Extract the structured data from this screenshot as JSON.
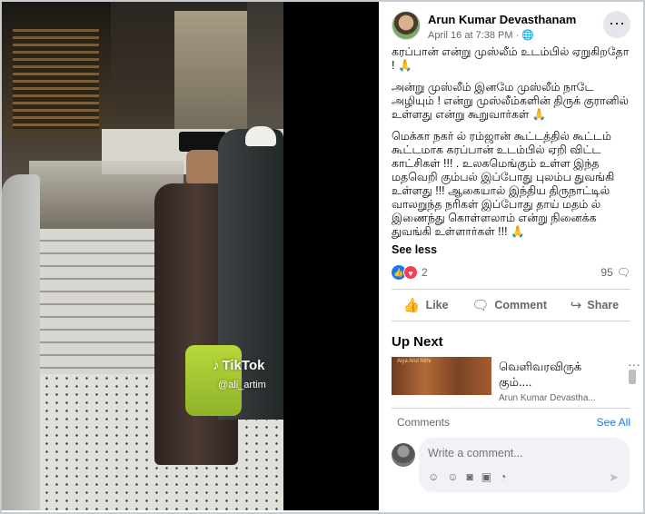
{
  "video": {
    "watermark_brand": "TikTok",
    "watermark_handle": "@ali_artim"
  },
  "post": {
    "author": "Arun Kumar Devasthanam",
    "date": "April 16 at 7:38 PM",
    "privacy_icon": "globe-icon",
    "more_icon": "more-icon",
    "paragraphs": [
      "கரப்பான் என்று முஸ்லீம் உடம்பில் ஏறுகிறதோ ! 🙏",
      "அன்று முஸ்லீம் இனமே முஸ்லீம் நாடே அழியும் ! என்று முஸ்லீம்களின் திருக் குரானில் உள்ளது என்று கூறுவார்கள் 🙏",
      "மெக்கா நகர் ல் ரம்ஜான் கூட்டத்தில் கூட்டம் கூட்டமாக கரப்பான் உடம்பில் ஏறி விட்ட காட்சிகள் !!! . உலகமெங்கும் உள்ள இந்த மதவெறி கும்பல் இப்போது புலம்ப துவங்கி உள்ளது !!! ஆகையால் இந்திய திருநாட்டில் வாலறுந்த நரிகள் இப்போது தாய் மதம் ல் இணைந்து கொள்ளலாம் என்று நினைக்க துவங்கி உள்ளார்கள் !!! 🙏"
    ],
    "see_less": "See less",
    "reaction_count": "2",
    "comment_count": "95"
  },
  "actions": {
    "like": "Like",
    "comment": "Comment",
    "share": "Share"
  },
  "up_next": {
    "title": "Up Next",
    "item_title": "வெளிவரவிருக் கும்....",
    "item_author": "Arun Kumar Devastha...",
    "thumb_text": "Aiya  Arul Nithi"
  },
  "comments": {
    "label": "Comments",
    "see_all": "See All",
    "placeholder": "Write a comment..."
  }
}
